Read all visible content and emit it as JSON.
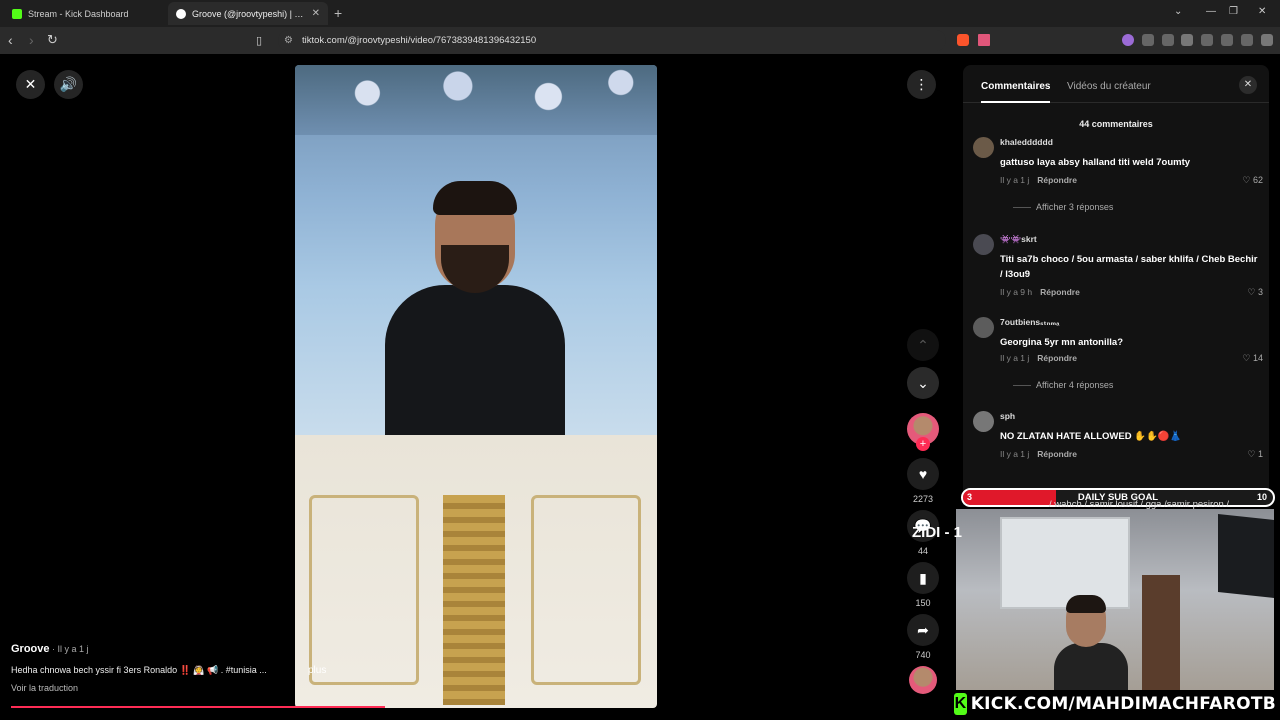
{
  "browser": {
    "tabs": [
      {
        "title": "Stream - Kick Dashboard",
        "favicon_color": "#53fc18"
      },
      {
        "title": "Groove (@jroovtypeshi) | TikT",
        "favicon_color": "#ffffff"
      }
    ],
    "url": "tiktok.com/@jroovtypeshi/video/7673839481396432150"
  },
  "player": {
    "close_icon": "close-icon",
    "volume_icon": "volume-icon",
    "more_icon": "more-icon",
    "caption_more": "plus"
  },
  "rail": {
    "likes": "2273",
    "comments": "44",
    "saves": "150",
    "shares": "740"
  },
  "caption": {
    "author": "Groove",
    "time": " · Il y a 1 j",
    "text": "Hedha chnowa bech yssir fi 3ers Ronaldo ‼️ 👰 📢 . #tunisia ...",
    "translate": "Voir la traduction",
    "progress": 0.5
  },
  "comments": {
    "tab_comments": "Commentaires",
    "tab_creator": "Vidéos du créateur",
    "count": "44 commentaires",
    "items": [
      {
        "user": "khaledddddd",
        "text": "gattuso laya absy halland titi weld 7oumty",
        "time": "Il y a 1 j",
        "reply": "Répondre",
        "likes": "62",
        "replies": "Afficher 3 réponses"
      },
      {
        "user": "👾👾skrt",
        "text": "Titi sa7b choco / 5ou armasta / saber khlifa / Cheb Bechir / l3ou9",
        "time": "Il y a 9 h",
        "reply": "Répondre",
        "likes": "3"
      },
      {
        "user": "7outbiensₛₜₙₘₐ",
        "text": "Georgina 5yr mn antonilla?",
        "time": "Il y a 1 j",
        "reply": "Répondre",
        "likes": "14",
        "replies": "Afficher 4 réponses"
      },
      {
        "user": "sph",
        "text": "NO ZLATAN HATE ALLOWED ✋✋🔴👗",
        "time": "Il y a 1 j",
        "reply": "Répondre",
        "likes": "1"
      }
    ]
  },
  "overlay": {
    "subgoal_label": "DAILY SUB GOAL",
    "subgoal_current": "3",
    "subgoal_target": "10",
    "subgoal_fraction": 0.3,
    "ticker": "/ wahch / samir lousif / gga /samir pesiron /",
    "zidi": "ZIDI - 1",
    "kick_url": "KICK.COM/MAHDIMACHFAROTB",
    "colors": {
      "kick_green": "#53fc18",
      "goal_red": "#e0182a",
      "tiktok_red": "#fe2c55"
    }
  }
}
